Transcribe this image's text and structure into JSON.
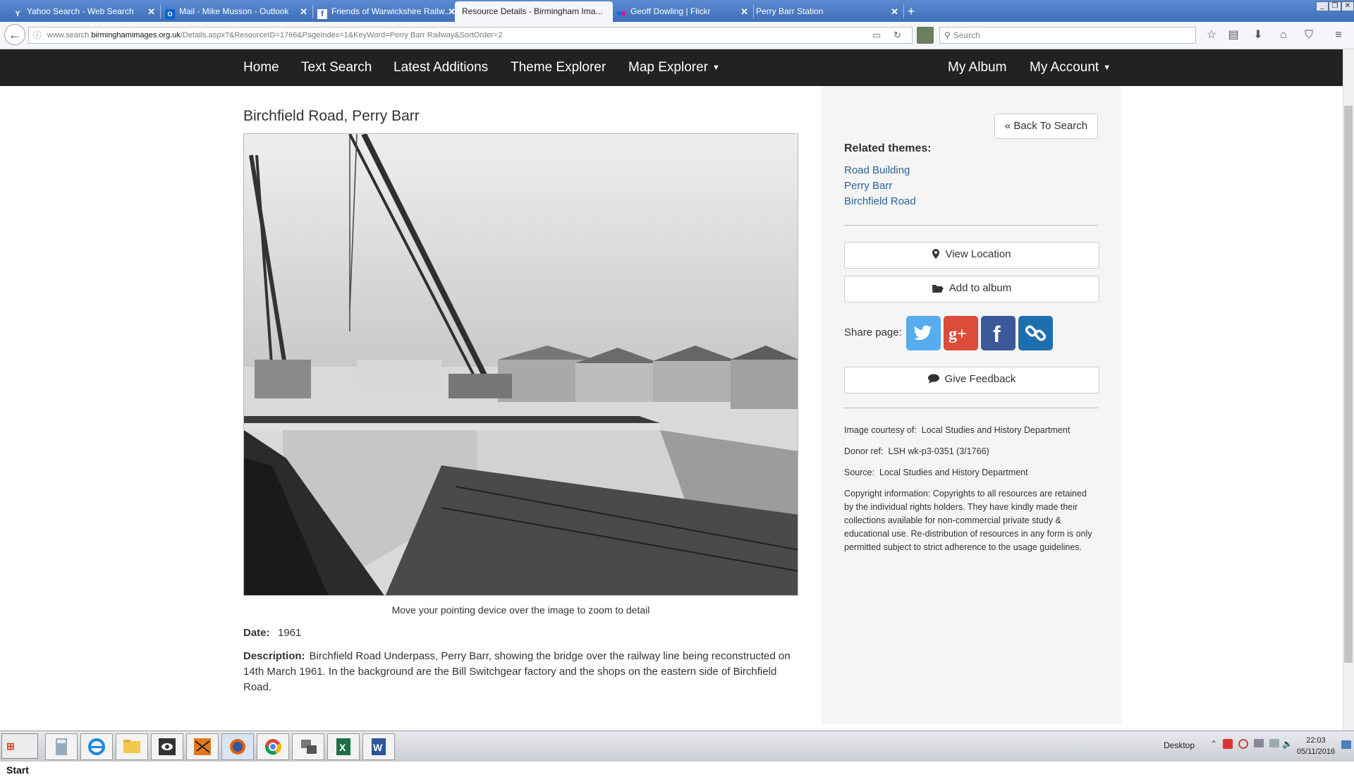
{
  "browser": {
    "tabs": [
      {
        "title": "Yahoo Search - Web Search",
        "icon": "yahoo-icon"
      },
      {
        "title": "Mail - Mike Musson - Outlook",
        "icon": "outlook-icon"
      },
      {
        "title": "Friends of Warwickshire Railw...",
        "icon": "facebook-icon"
      },
      {
        "title": "Resource Details - Birmingham Ima...",
        "icon": "none"
      },
      {
        "title": "Geoff Dowling | Flickr",
        "icon": "flickr-icon"
      },
      {
        "title": "Perry Barr Station",
        "icon": "none"
      }
    ],
    "url_prefix": "www.search.",
    "url_host": "birminghamimages.org.uk",
    "url_path": "/Details.aspx?&ResourceID=1766&PageIndex=1&KeyWord=Perry Barr Railway&SortOrder=2",
    "search_placeholder": "Search"
  },
  "nav": {
    "left": [
      "Home",
      "Text Search",
      "Latest Additions",
      "Theme Explorer",
      "Map Explorer"
    ],
    "right": [
      "My Album",
      "My Account"
    ]
  },
  "resource": {
    "title": "Birchfield Road, Perry Barr",
    "zoom_hint": "Move your pointing device over the image to zoom to detail",
    "date_label": "Date:",
    "date": "1961",
    "description_label": "Description:",
    "description": "Birchfield Road Underpass, Perry Barr, showing the bridge over the railway line being reconstructed on 14th March 1961. In the background are the Bill Switchgear factory and the shops on the eastern side of Birchfield Road."
  },
  "sidebar": {
    "back_label": "« Back To Search",
    "related_heading": "Related themes:",
    "themes": [
      "Road Building",
      "Perry Barr",
      "Birchfield Road"
    ],
    "view_location": "View Location",
    "add_album": "Add to album",
    "share_label": "Share page:",
    "feedback": "Give Feedback",
    "courtesy_label": "Image courtesy of:",
    "courtesy": "Local Studies and History Department",
    "donor_label": "Donor ref:",
    "donor": "LSH wk-p3-0351 (3/1766)",
    "source_label": "Source:",
    "source": "Local Studies and History Department",
    "copyright": "Copyright information: Copyrights to all resources are retained by the individual rights holders. They have kindly made their collections available for non-commercial private study & educational use. Re-distribution of resources in any form is only permitted subject to strict adherence to the usage guidelines."
  },
  "share_colors": {
    "twitter": "#55acee",
    "google": "#dd4b39",
    "facebook": "#3b5998",
    "link": "#1e6fb0"
  },
  "taskbar": {
    "start": "Start",
    "desktop": "Desktop",
    "time": "22:03",
    "date": "05/11/2016"
  }
}
